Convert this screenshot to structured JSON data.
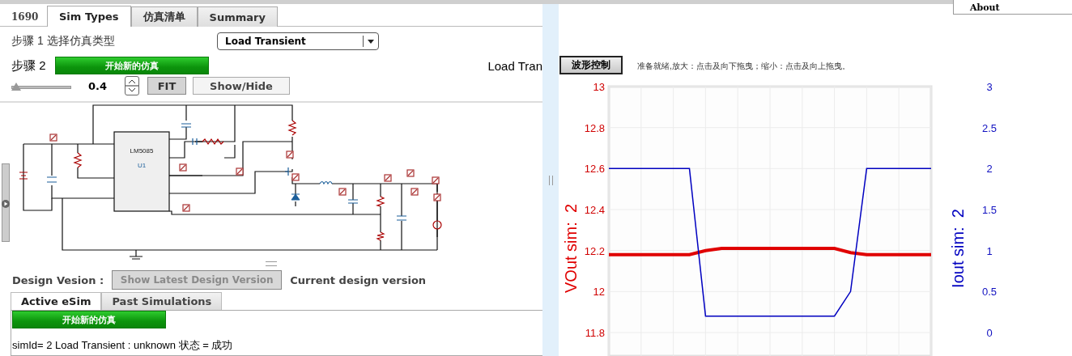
{
  "project_id": "1690",
  "tabs": [
    {
      "label": "Sim Types",
      "selected": true
    },
    {
      "label": "仿真清单",
      "selected": false
    },
    {
      "label": "Summary",
      "selected": false
    }
  ],
  "about_link": "About",
  "step1": {
    "label": "步骤 1 选择仿真类型",
    "sim_type": "Load Transient"
  },
  "step2": {
    "label": "步骤 2",
    "start_button": "开始新的仿真",
    "sim_title": "Load Tran"
  },
  "zoom_controls": {
    "level": 0.0,
    "value": "0.4",
    "fit_button": "FIT",
    "show_hide_button": "Show/Hide"
  },
  "schematic": {
    "chip_name": "LM5085",
    "chip_ref": "U1"
  },
  "design_version": {
    "label": "Design Vesion :",
    "button": "Show Latest Design Version",
    "button_disabled": true,
    "current": "Current design version"
  },
  "sim_tabs": [
    {
      "label": "Active eSim",
      "selected": true
    },
    {
      "label": "Past Simulations",
      "selected": false
    }
  ],
  "sim_panel": {
    "start_button": "开始新的仿真",
    "status": "simId= 2 Load Transient : unknown 状态 = 成功"
  },
  "waveform": {
    "control_button": "波形控制",
    "hint": "准备就绪,放大：点击及向下拖曳；缩小：点击及向上拖曳。",
    "chart_data": {
      "type": "line",
      "grid": true,
      "series": [
        {
          "name": "VOut sim:  2",
          "color": "#e00000",
          "axis": "y",
          "values": [
            12.18,
            12.18,
            12.18,
            12.18,
            12.18,
            12.18,
            12.2,
            12.21,
            12.21,
            12.21,
            12.21,
            12.21,
            12.21,
            12.21,
            12.21,
            12.19,
            12.18,
            12.18,
            12.18,
            12.18,
            12.18
          ]
        },
        {
          "name": "Iout sim:  2",
          "color": "#0000c0",
          "axis": "y2",
          "values": [
            2,
            2,
            2,
            2,
            2,
            2,
            0.2,
            0.2,
            0.2,
            0.2,
            0.2,
            0.2,
            0.2,
            0.2,
            0.2,
            0.5,
            2,
            2,
            2,
            2,
            2
          ]
        }
      ],
      "ylim": [
        11.8,
        13
      ],
      "yticks": [
        11.8,
        12,
        12.2,
        12.4,
        12.6,
        12.8,
        13
      ],
      "y2lim": [
        0,
        3
      ],
      "y2ticks": [
        0,
        0.5,
        1,
        1.5,
        2,
        2.5,
        3
      ]
    }
  }
}
